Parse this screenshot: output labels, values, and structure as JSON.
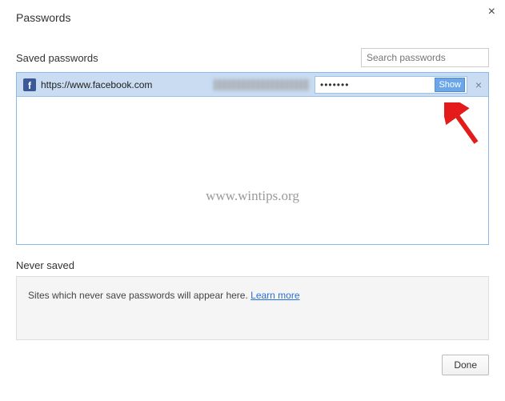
{
  "title": "Passwords",
  "close_glyph": "×",
  "saved": {
    "label": "Saved passwords",
    "search_placeholder": "Search passwords",
    "entries": [
      {
        "icon_letter": "f",
        "url": "https://www.facebook.com",
        "password_mask": "•••••••",
        "show_label": "Show",
        "remove_glyph": "×"
      }
    ]
  },
  "watermark": "www.wintips.org",
  "never": {
    "label": "Never saved",
    "text": "Sites which never save passwords will appear here. ",
    "link": "Learn more"
  },
  "footer": {
    "done": "Done"
  }
}
